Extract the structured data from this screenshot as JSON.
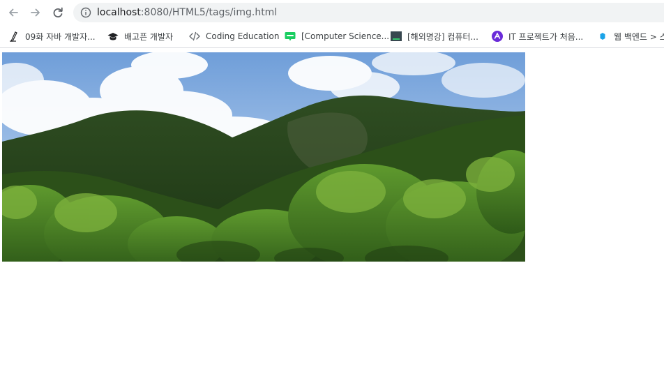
{
  "browser": {
    "url_host": "localhost",
    "url_rest": ":8080/HTML5/tags/img.html"
  },
  "bookmarks": [
    {
      "icon": "pen-nib-icon",
      "label": "09화 자바 개발자..."
    },
    {
      "icon": "graduation-cap-icon",
      "label": "배고픈 개발자"
    },
    {
      "icon": "code-brackets-icon",
      "label": "Coding Education"
    },
    {
      "icon": "blog-chat-icon",
      "label": "[Computer Science..."
    },
    {
      "icon": "terminal-window-icon",
      "label": "[해외명강] 컴퓨터..."
    },
    {
      "icon": "purple-circle-logo-icon",
      "label": "IT 프로젝트가 처음..."
    },
    {
      "icon": "blue-drop-icon",
      "label": "웹 백엔드 > 스"
    }
  ],
  "page": {
    "image_alt": "mountain landscape photo"
  }
}
